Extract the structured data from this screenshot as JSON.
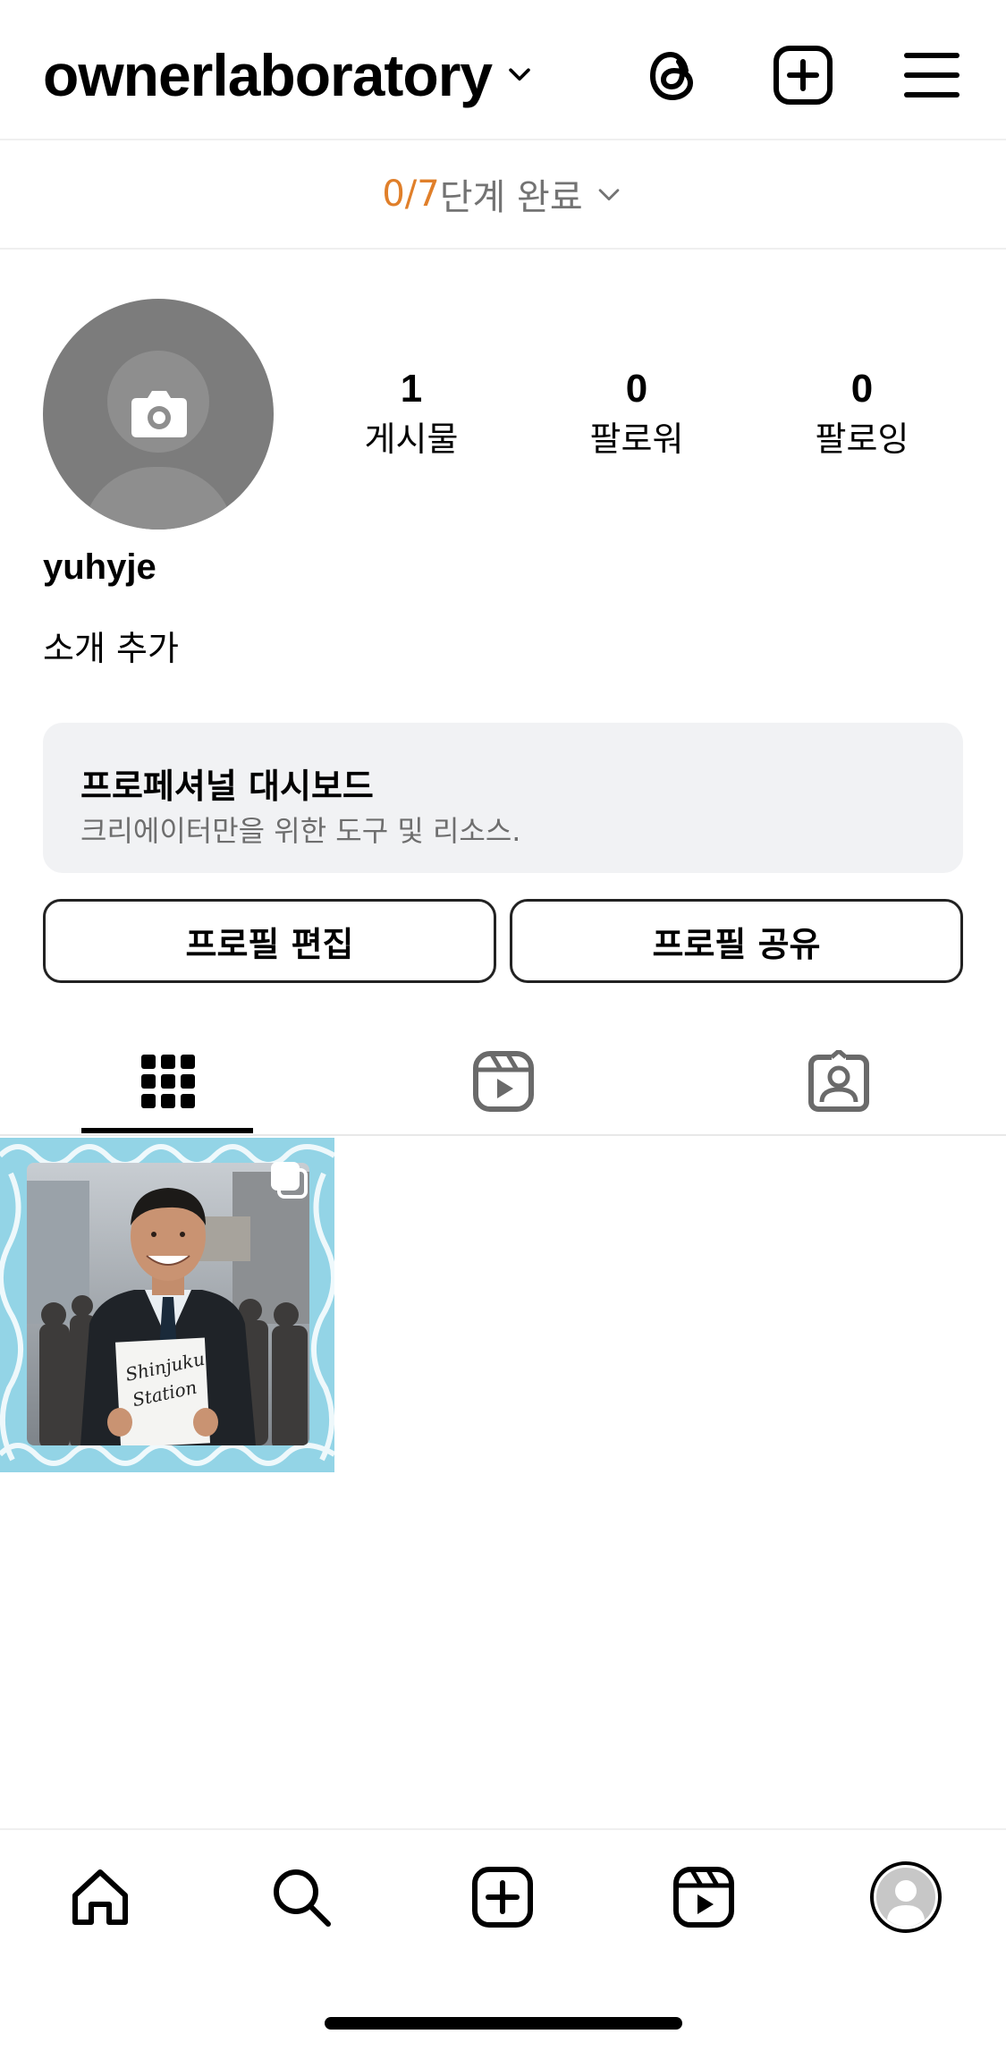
{
  "header": {
    "username": "ownerlaboratory"
  },
  "progress": {
    "count": "0/7",
    "label": "단계 완료"
  },
  "profile": {
    "stats": [
      {
        "value": "1",
        "label": "게시물"
      },
      {
        "value": "0",
        "label": "팔로워"
      },
      {
        "value": "0",
        "label": "팔로잉"
      }
    ],
    "display_name": "yuhyje",
    "bio_placeholder": "소개 추가"
  },
  "dashboard": {
    "title": "프로페셔널 대시보드",
    "subtitle": "크리에이터만을 위한 도구 및 리소스."
  },
  "buttons": {
    "edit_profile": "프로필 편집",
    "share_profile": "프로필 공유"
  },
  "tabs": [
    "posts-grid",
    "reels",
    "tagged"
  ],
  "posts": [
    {
      "image_text": "Shinjuku Station",
      "multi_photo": true
    }
  ],
  "bottom_nav": [
    "home-icon",
    "search-icon",
    "create-icon",
    "reels-icon",
    "profile-avatar"
  ],
  "colors": {
    "progress_accent": "#e07f2a",
    "post_background": "#93d4e6",
    "dashboard_bg": "#f1f2f4"
  }
}
